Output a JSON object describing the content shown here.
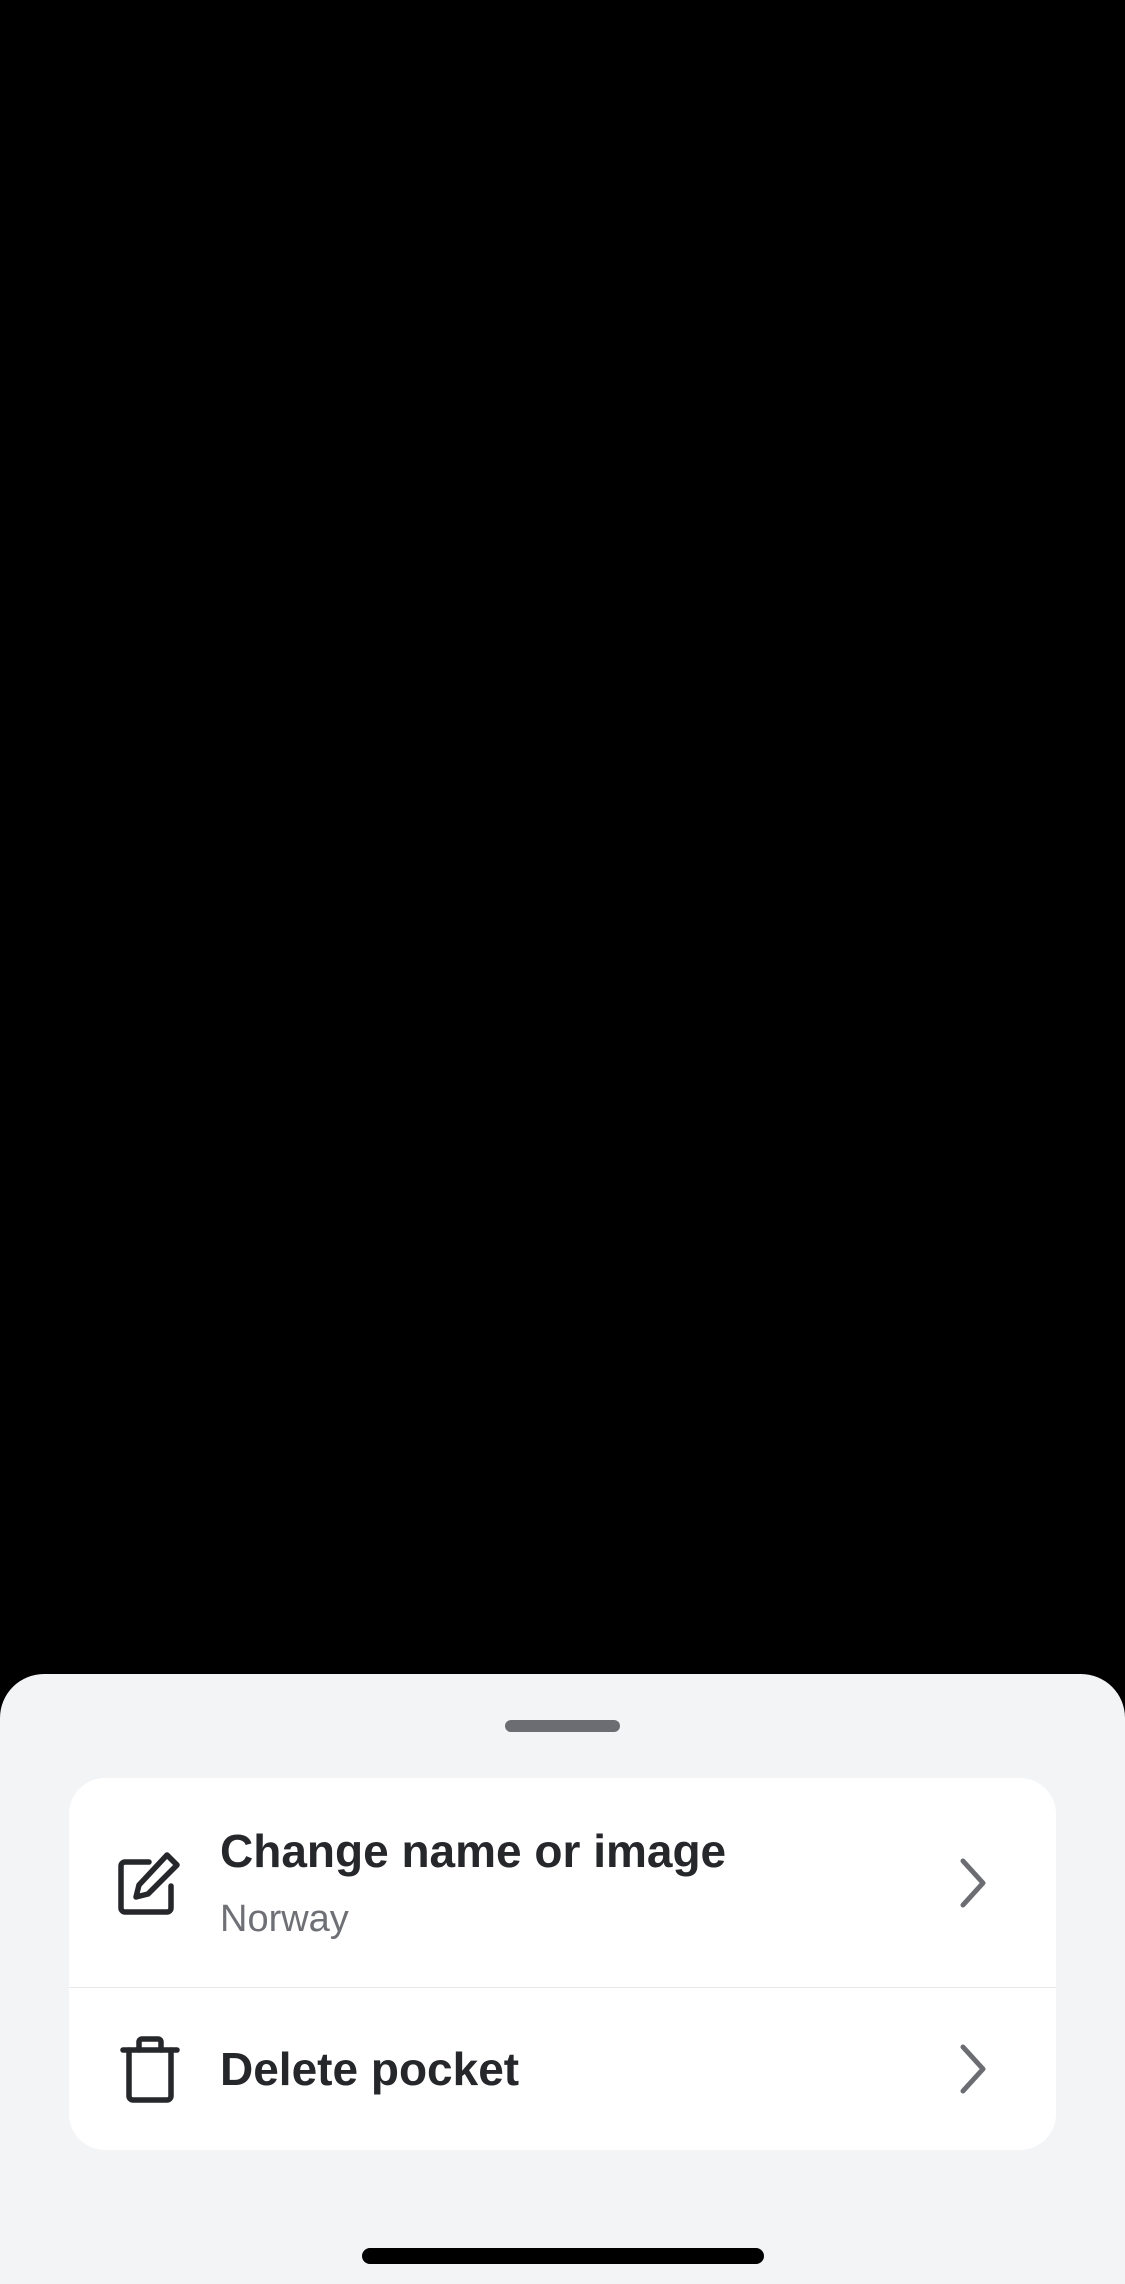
{
  "sheet": {
    "background": "#f3f4f6",
    "items": [
      {
        "title": "Change name or image",
        "subtitle": "Norway",
        "icon": "edit-icon"
      },
      {
        "title": "Delete pocket",
        "icon": "trash-icon"
      }
    ]
  },
  "colors": {
    "backdrop": "#000000",
    "card": "#ffffff",
    "title_text": "#26272b",
    "subtitle_text": "#6e7075",
    "chevron": "#6b6d72"
  }
}
